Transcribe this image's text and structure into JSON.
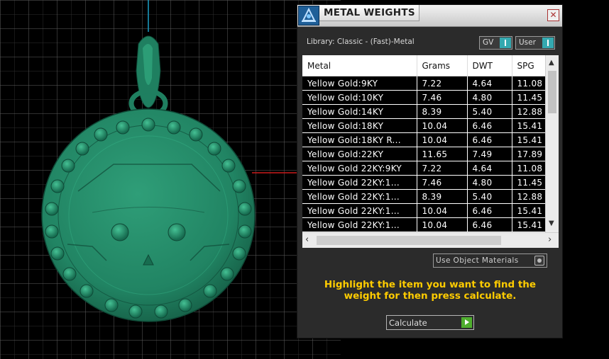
{
  "viewport": {
    "model_color": "#238a66",
    "grid_color": "#5f5f5f",
    "axis_color_x": "#cc1a1a",
    "axis_color_y": "#1aa0c8"
  },
  "panel": {
    "title": "METAL WEIGHTS",
    "close_icon": "close-x",
    "library_label": "Library: Classic - (Fast)-Metal",
    "toggle_gv_label": "GV",
    "toggle_user_label": "User",
    "table": {
      "headers": [
        "Metal",
        "Grams",
        "DWT",
        "SPG"
      ],
      "rows": [
        [
          "Yellow Gold:9KY",
          "7.22",
          "4.64",
          "11.08"
        ],
        [
          "Yellow Gold:10KY",
          "7.46",
          "4.80",
          "11.45"
        ],
        [
          "Yellow Gold:14KY",
          "8.39",
          "5.40",
          "12.88"
        ],
        [
          "Yellow Gold:18KY",
          "10.04",
          "6.46",
          "15.41"
        ],
        [
          "Yellow Gold:18KY R...",
          "10.04",
          "6.46",
          "15.41"
        ],
        [
          "Yellow Gold:22KY",
          "11.65",
          "7.49",
          "17.89"
        ],
        [
          "Yellow Gold 22KY:9KY",
          "7.22",
          "4.64",
          "11.08"
        ],
        [
          "Yellow Gold 22KY:1...",
          "7.46",
          "4.80",
          "11.45"
        ],
        [
          "Yellow Gold 22KY:1...",
          "8.39",
          "5.40",
          "12.88"
        ],
        [
          "Yellow Gold 22KY:1...",
          "10.04",
          "6.46",
          "15.41"
        ],
        [
          "Yellow Gold 22KY:1...",
          "10.04",
          "6.46",
          "15.41"
        ]
      ]
    },
    "use_object_materials_label": "Use Object Materials",
    "instructions": "Highlight the item you want to find the weight for then press calculate.",
    "calculate_label": "Calculate",
    "accent_color": "#ffcc00",
    "toggle_color": "#34a9b0",
    "calculate_icon_color": "#4fae2e"
  }
}
